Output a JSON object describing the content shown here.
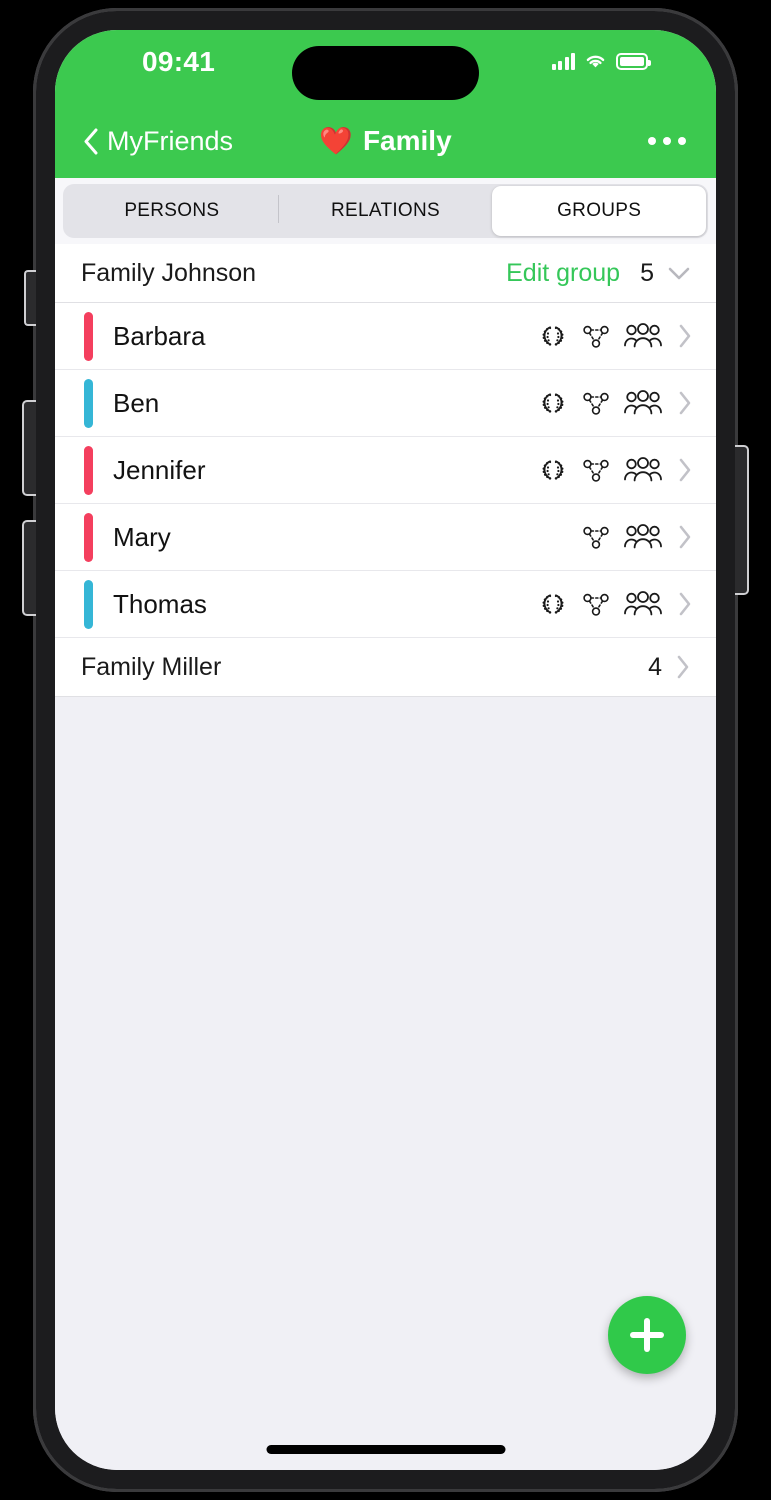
{
  "status_bar": {
    "time": "09:41",
    "signal_icon": "cellular-signal-icon",
    "wifi_icon": "wifi-icon",
    "battery_icon": "battery-icon"
  },
  "nav_bar": {
    "back_label": "MyFriends",
    "back_icon": "chevron-left-icon",
    "title_emoji": "❤️",
    "title": "Family",
    "more_icon": "more-horizontal-icon"
  },
  "segmented_control": {
    "tabs": [
      {
        "label": "PERSONS",
        "active": false
      },
      {
        "label": "RELATIONS",
        "active": false
      },
      {
        "label": "GROUPS",
        "active": true
      }
    ]
  },
  "groups": [
    {
      "name": "Family Johnson",
      "edit_label": "Edit group",
      "count": "5",
      "expanded": true,
      "chevron_icon": "chevron-down-icon",
      "members": [
        {
          "name": "Barbara",
          "gender_color": "#f43f5e",
          "icons": [
            "laurel-wreath-icon",
            "relations-network-icon",
            "people-group-icon"
          ],
          "chevron_icon": "chevron-right-icon"
        },
        {
          "name": "Ben",
          "gender_color": "#35b6d6",
          "icons": [
            "laurel-wreath-icon",
            "relations-network-icon",
            "people-group-icon"
          ],
          "chevron_icon": "chevron-right-icon"
        },
        {
          "name": "Jennifer",
          "gender_color": "#f43f5e",
          "icons": [
            "laurel-wreath-icon",
            "relations-network-icon",
            "people-group-icon"
          ],
          "chevron_icon": "chevron-right-icon"
        },
        {
          "name": "Mary",
          "gender_color": "#f43f5e",
          "icons": [
            "relations-network-icon",
            "people-group-icon"
          ],
          "chevron_icon": "chevron-right-icon"
        },
        {
          "name": "Thomas",
          "gender_color": "#35b6d6",
          "icons": [
            "laurel-wreath-icon",
            "relations-network-icon",
            "people-group-icon"
          ],
          "chevron_icon": "chevron-right-icon"
        }
      ]
    },
    {
      "name": "Family Miller",
      "edit_label": "",
      "count": "4",
      "expanded": false,
      "chevron_icon": "chevron-right-icon",
      "members": []
    }
  ],
  "fab": {
    "icon": "plus-icon"
  },
  "colors": {
    "header_green": "#3cc94f",
    "accent_green": "#35c759",
    "fab_green": "#30c94a",
    "female_bar": "#f43f5e",
    "male_bar": "#35b6d6",
    "page_background": "#f0f0f5"
  }
}
